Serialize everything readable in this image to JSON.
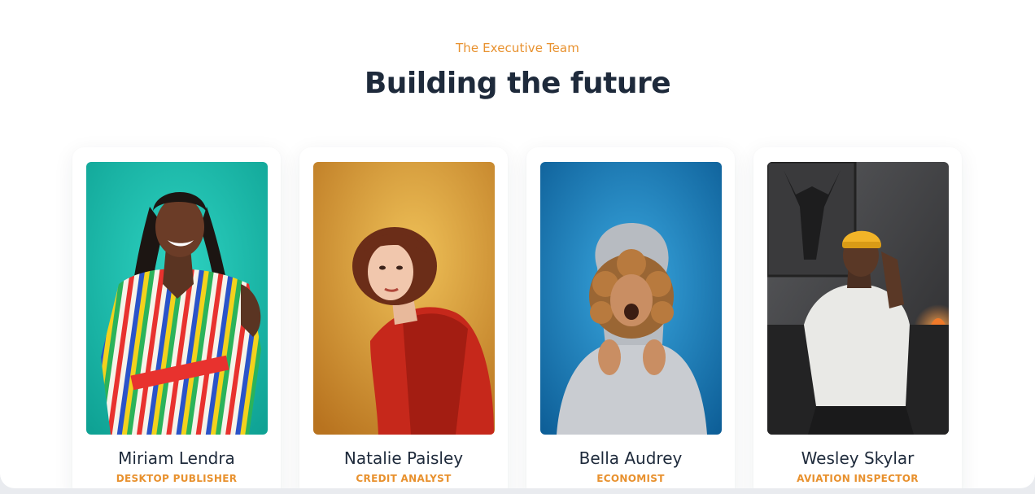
{
  "section": {
    "eyebrow": "The Executive Team",
    "headline": "Building the future"
  },
  "team": [
    {
      "name": "Miriam Lendra",
      "role": "DESKTOP PUBLISHER",
      "photo_bg": "#18b5a8"
    },
    {
      "name": "Natalie Paisley",
      "role": "CREDIT ANALYST",
      "photo_bg": "#d79a32"
    },
    {
      "name": "Bella Audrey",
      "role": "ECONOMIST",
      "photo_bg": "#1f82bf"
    },
    {
      "name": "Wesley Skylar",
      "role": "AVIATION INSPECTOR",
      "photo_bg": "#4a4a4d"
    }
  ],
  "colors": {
    "accent": "#e8912e",
    "heading": "#1e2a3b"
  }
}
